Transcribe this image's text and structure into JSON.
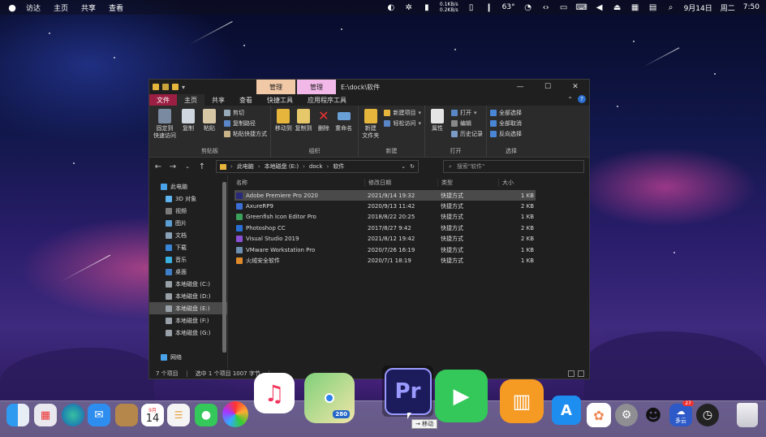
{
  "menubar": {
    "app_name": "访达",
    "menus": [
      "主页",
      "共享",
      "查看"
    ],
    "net_up": "0.1KB/s",
    "net_down": "0.2KB/s",
    "temp": "63°",
    "date": "9月14日",
    "weekday": "周二",
    "time": "7:50"
  },
  "window": {
    "ctx_tab_a": "管理",
    "ctx_tab_b": "管理",
    "path_title": "E:\\dock\\软件",
    "controls": {
      "minimize": "—",
      "maximize": "☐",
      "close": "✕"
    }
  },
  "ribbon_tabs": [
    "文件",
    "主页",
    "共享",
    "查看",
    "快捷工具",
    "应用程序工具"
  ],
  "ribbon": {
    "clipboard": {
      "label": "剪贴板",
      "pin": "固定到\n快速访问",
      "copy": "复制",
      "paste": "粘贴",
      "cut": "剪切",
      "copy_path": "复制路径",
      "paste_shortcut": "粘贴快捷方式"
    },
    "organize": {
      "label": "组织",
      "move_to": "移动到",
      "copy_to": "复制到",
      "delete": "删除",
      "rename": "重命名"
    },
    "new": {
      "label": "新建",
      "new_folder": "新建\n文件夹",
      "new_item": "新建项目",
      "easy_access": "轻松访问"
    },
    "open": {
      "label": "打开",
      "properties": "属性",
      "open": "打开",
      "edit": "编辑",
      "history": "历史记录"
    },
    "select": {
      "label": "选择",
      "select_all": "全部选择",
      "select_none": "全部取消",
      "invert": "反向选择"
    }
  },
  "address": {
    "crumbs": [
      "此电脑",
      "本地磁盘 (E:)",
      "dock",
      "软件"
    ],
    "search_placeholder": "搜索\"软件\""
  },
  "nav": [
    {
      "label": "此电脑",
      "child": false,
      "color": "#4aa3e8"
    },
    {
      "label": "3D 对象",
      "child": true,
      "color": "#5fb4f0"
    },
    {
      "label": "视频",
      "child": true,
      "color": "#7a7a7a"
    },
    {
      "label": "图片",
      "child": true,
      "color": "#5b9fd4"
    },
    {
      "label": "文档",
      "child": true,
      "color": "#8aa2b8"
    },
    {
      "label": "下载",
      "child": true,
      "color": "#3a86d6"
    },
    {
      "label": "音乐",
      "child": true,
      "color": "#3ab0e0"
    },
    {
      "label": "桌面",
      "child": true,
      "color": "#3f7fc9"
    },
    {
      "label": "本地磁盘 (C:)",
      "child": true,
      "color": "#9aa0a8"
    },
    {
      "label": "本地磁盘 (D:)",
      "child": true,
      "color": "#9aa0a8"
    },
    {
      "label": "本地磁盘 (E:)",
      "child": true,
      "color": "#9aa0a8",
      "selected": true
    },
    {
      "label": "本地磁盘 (F:)",
      "child": true,
      "color": "#9aa0a8"
    },
    {
      "label": "本地磁盘 (G:)",
      "child": true,
      "color": "#9aa0a8"
    },
    {
      "label": "",
      "child": false,
      "color": "transparent",
      "spacer": true
    },
    {
      "label": "网络",
      "child": false,
      "color": "#4aa3e8"
    }
  ],
  "columns": {
    "name": "名称",
    "date": "修改日期",
    "type": "类型",
    "size": "大小"
  },
  "files": [
    {
      "name": "Adobe Premiere Pro 2020",
      "date": "2021/9/14 19:32",
      "type": "快捷方式",
      "size": "1 KB",
      "color": "#2a2a7a",
      "selected": true
    },
    {
      "name": "AxureRP9",
      "date": "2020/9/13 11:42",
      "type": "快捷方式",
      "size": "2 KB",
      "color": "#3b6fd6"
    },
    {
      "name": "Greenfish Icon Editor Pro",
      "date": "2018/8/22 20:25",
      "type": "快捷方式",
      "size": "1 KB",
      "color": "#3aa05a"
    },
    {
      "name": "Photoshop CC",
      "date": "2017/8/27 9:42",
      "type": "快捷方式",
      "size": "2 KB",
      "color": "#2a6fd6"
    },
    {
      "name": "Visual Studio 2019",
      "date": "2021/8/12 19:42",
      "type": "快捷方式",
      "size": "2 KB",
      "color": "#8a4fd6"
    },
    {
      "name": "VMware Workstation Pro",
      "date": "2020/7/26 16:19",
      "type": "快捷方式",
      "size": "1 KB",
      "color": "#6d8fb0"
    },
    {
      "name": "火绒安全软件",
      "date": "2020/7/1 18:19",
      "type": "快捷方式",
      "size": "1 KB",
      "color": "#e08a2a"
    }
  ],
  "status": {
    "count": "7 个项目",
    "selection": "选中 1 个项目  1007 字节"
  },
  "dock": {
    "calendar_month": "9月",
    "calendar_day": "14",
    "pr_label": "Pr",
    "map_badge": "280",
    "qq_badge": "27",
    "weather_label": "多云",
    "drag_tip": "→ 移动"
  },
  "colors": {
    "accent_file_tab": "#9b1f43",
    "ctx_tab_a": "#f2c9a6",
    "ctx_tab_b": "#f2b8e8",
    "selection": "#4a4a4a"
  }
}
